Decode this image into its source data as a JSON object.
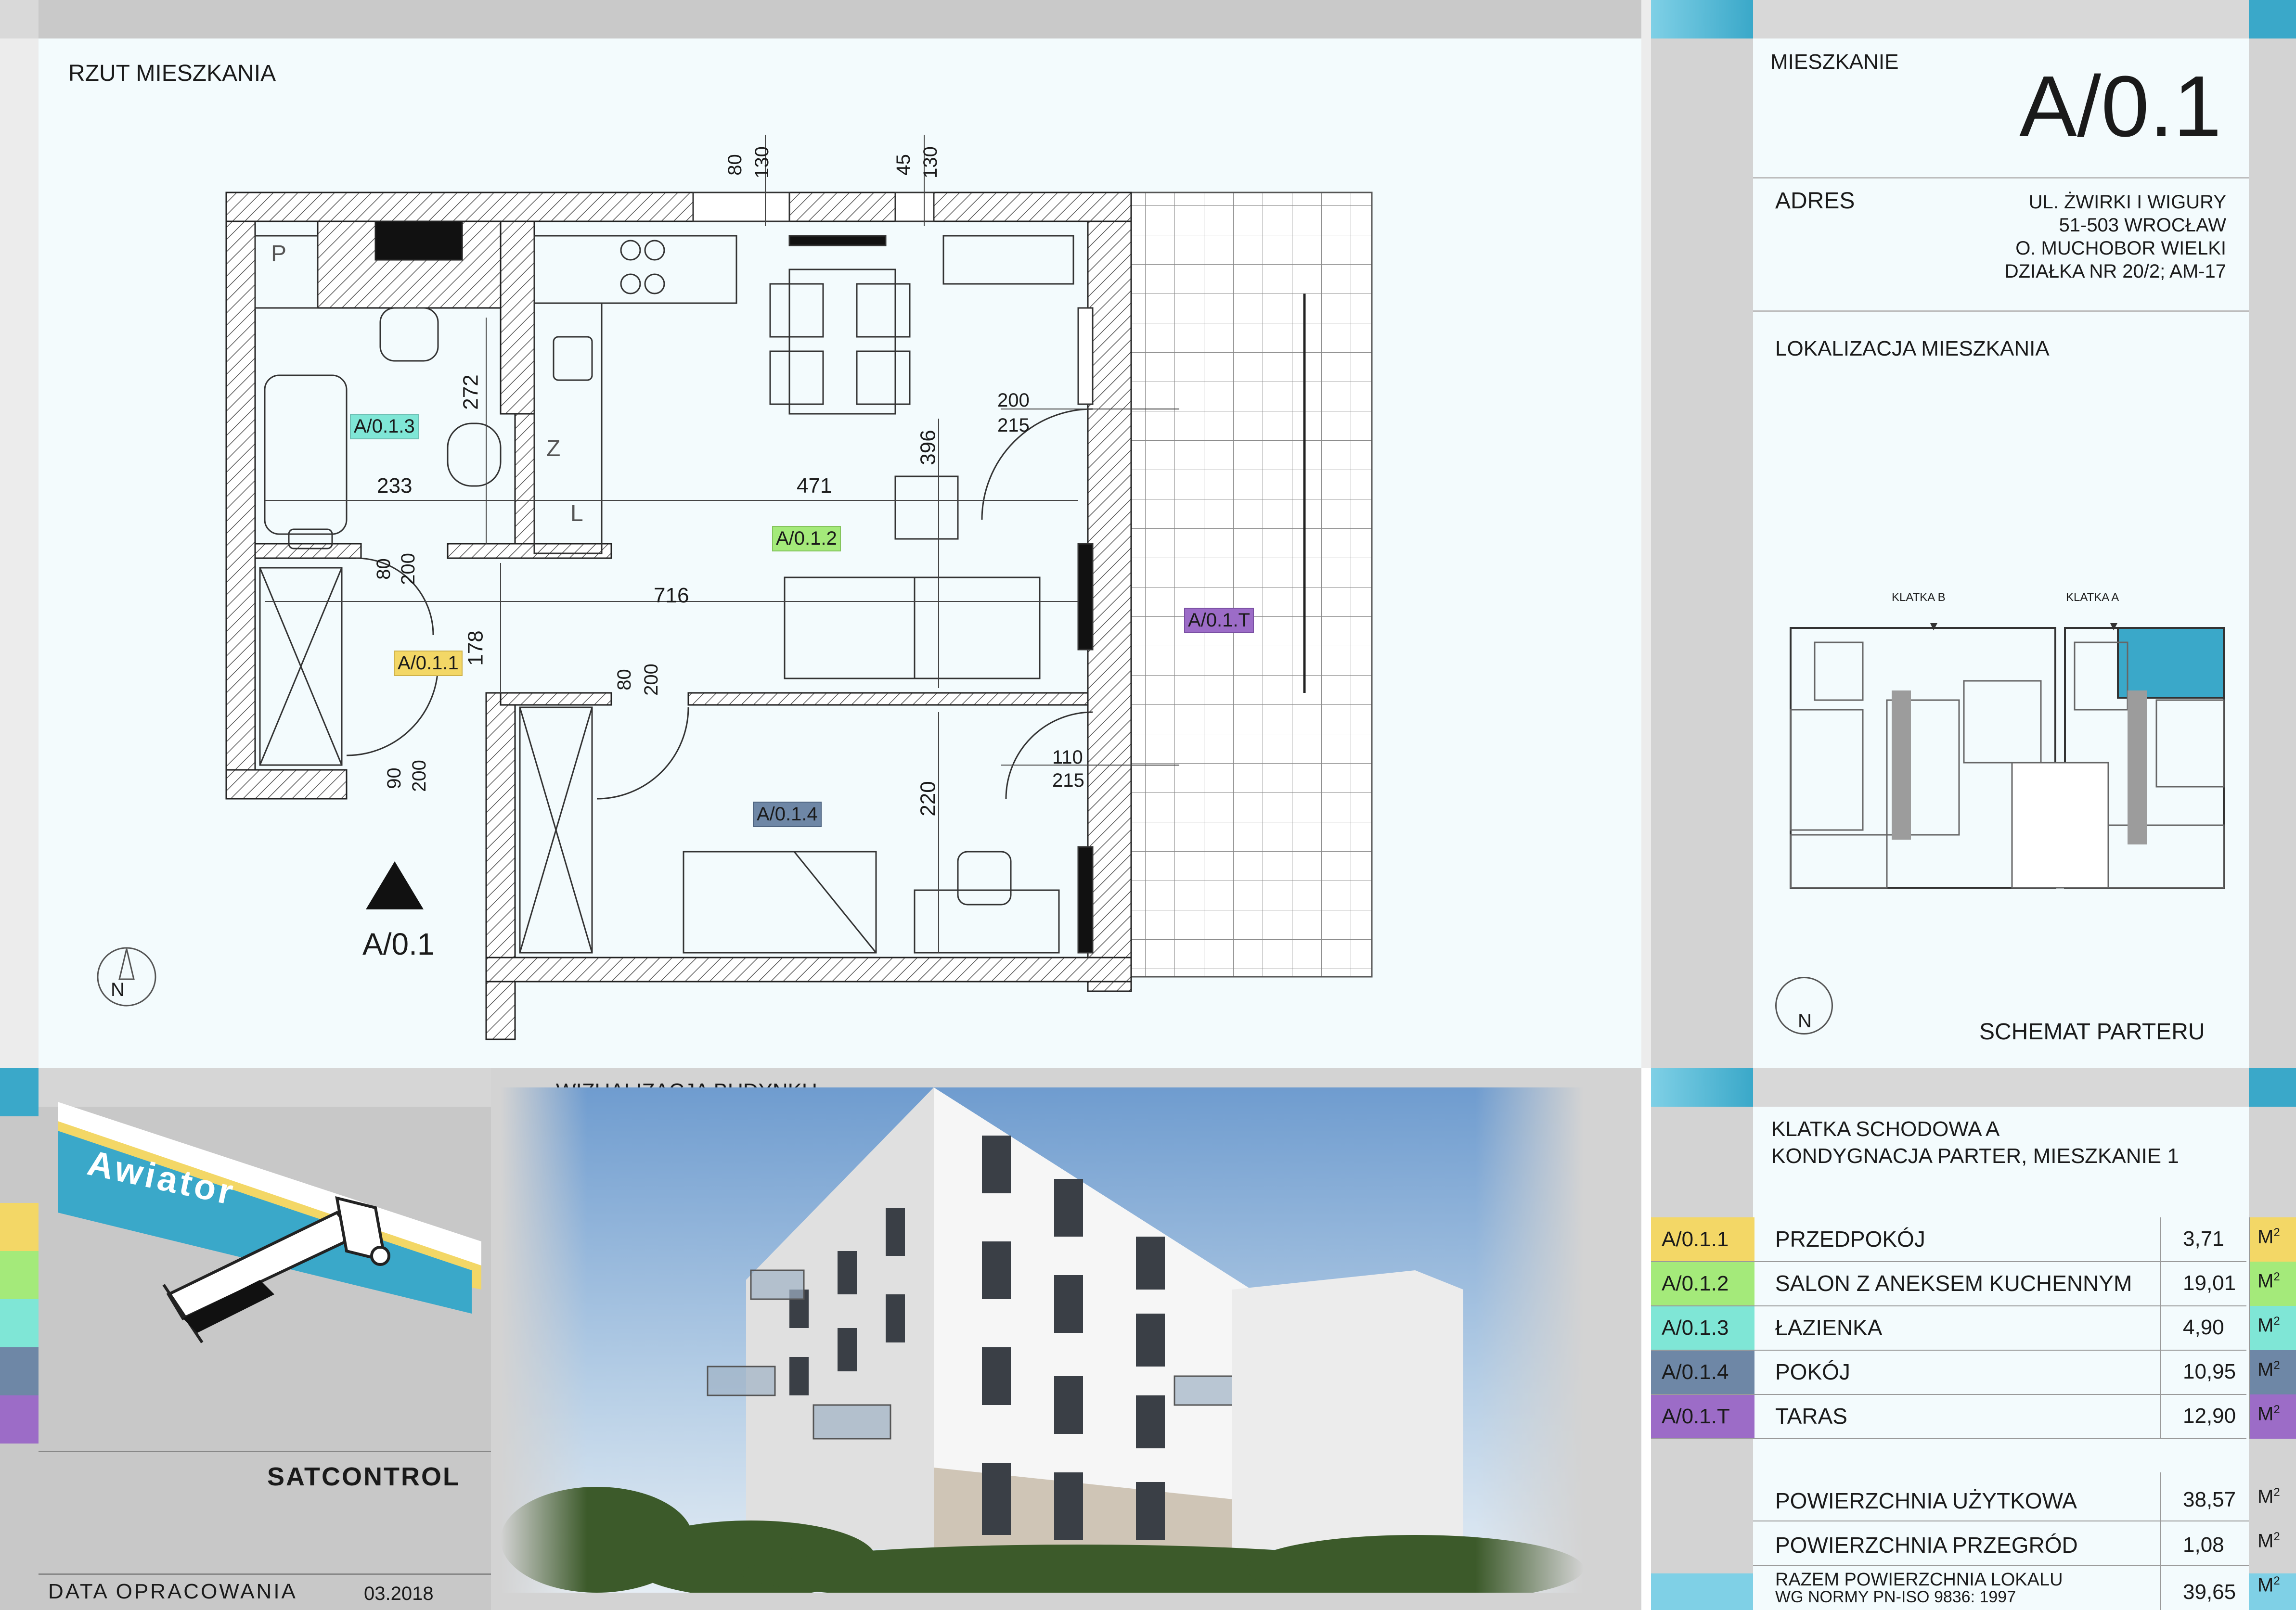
{
  "plan": {
    "title": "RZUT MIESZKANIA",
    "unit_marker": "A/0.1",
    "north": "N",
    "dimensions": {
      "d80a": "80",
      "d130a": "130",
      "d45": "45",
      "d130b": "130",
      "d272": "272",
      "d233": "233",
      "d471": "471",
      "d396": "396",
      "d200a": "200",
      "d215a": "215",
      "d80b": "80",
      "d200b": "200",
      "d716": "716",
      "d178": "178",
      "d80c": "80",
      "d200c": "200",
      "d90": "90",
      "d200d": "200",
      "d110": "110",
      "d215b": "215",
      "d220": "220"
    },
    "fixtures": {
      "p": "P",
      "z": "Z",
      "l": "L"
    },
    "room_tags": [
      {
        "code": "A/0.1.3",
        "color": "#7fe6d6"
      },
      {
        "code": "A/0.1.2",
        "color": "#a4ea7a"
      },
      {
        "code": "A/0.1.1",
        "color": "#f3d766"
      },
      {
        "code": "A/0.1.4",
        "color": "#6e87a6"
      },
      {
        "code": "A/0.1.T",
        "color": "#9c6cc7"
      }
    ]
  },
  "header": {
    "mieszkanie_label": "MIESZKANIE",
    "mieszkanie_value": "A/0.1",
    "adres_label": "ADRES",
    "address_lines": [
      "UL. ŻWIRKI I WIGURY",
      "51-503 WROCŁAW",
      "O. MUCHOBOR WIELKI",
      "DZIAŁKA NR 20/2; AM-17"
    ],
    "lokalizacja_label": "LOKALIZACJA MIESZKANIA",
    "klatka_b": "KLATKA B",
    "klatka_a": "KLATKA A",
    "schemat_label": "SCHEMAT PARTERU",
    "north": "N"
  },
  "logo": {
    "brand": "Awiator",
    "company": "SATCONTROL",
    "date_label": "DATA OPRACOWANIA",
    "date_value": "03.2018"
  },
  "visual": {
    "title": "WIZUALIZACJA  BUDYNKU"
  },
  "summary": {
    "line1": "KLATKA SCHODOWA A",
    "line2": "KONDYGNACJA  PARTER, MIESZKANIE 1",
    "unit": "M",
    "rooms": [
      {
        "code": "A/0.1.1",
        "name": "PRZEDPOKÓJ",
        "area": "3,71",
        "color": "#f3d766"
      },
      {
        "code": "A/0.1.2",
        "name": "SALON Z ANEKSEM KUCHENNYM",
        "area": "19,01",
        "color": "#a4ea7a"
      },
      {
        "code": "A/0.1.3",
        "name": "ŁAZIENKA",
        "area": "4,90",
        "color": "#7fe6d6"
      },
      {
        "code": "A/0.1.4",
        "name": "POKÓJ",
        "area": "10,95",
        "color": "#6e87a6"
      },
      {
        "code": "A/0.1.T",
        "name": "TARAS",
        "area": "12,90",
        "color": "#9c6cc7"
      }
    ],
    "totals": [
      {
        "name": "POWIERZCHNIA UŻYTKOWA",
        "value": "38,57"
      },
      {
        "name": "POWIERZCHNIA PRZEGRÓD",
        "value": "1,08"
      }
    ],
    "total_label_1": "RAZEM POWIERZCHNIA LOKALU",
    "total_label_2": "WG NORMY PN-ISO 9836: 1997",
    "total_value": "39,65"
  },
  "colors": {
    "accent_cyan": "#3aa8c9",
    "panel_bg": "#f5fcfe",
    "frame_grey": "#d6d6d6"
  }
}
